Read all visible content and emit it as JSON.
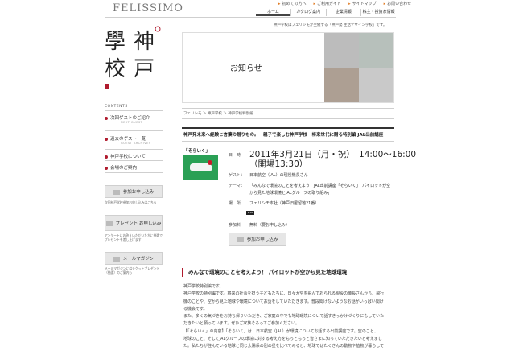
{
  "header": {
    "logo": "FELISSIMO",
    "top_links": [
      "初めての方へ",
      "ご利用ガイド",
      "サイトマップ",
      "お問い合わせ"
    ],
    "main_nav": [
      "ホーム",
      "カタログ案内",
      "企業情報",
      "株主・投資家情報"
    ]
  },
  "intro_text": "神戸学校はフェリシモが主催する「神戸発 生活デザイン学校」です。",
  "sidebar": {
    "stamp_text": "學神校戸",
    "contents_label": "CONTENTS",
    "items": [
      {
        "label": "次回ゲストのご紹介",
        "sub": "NEXT GUEST"
      },
      {
        "label": "過去のゲスト一覧",
        "sub": "GUEST ARCHIVES"
      },
      {
        "label": "神戸学校について",
        "sub": ""
      },
      {
        "label": "会場のご案内",
        "sub": ""
      }
    ],
    "apply_button": "参加お申し込み",
    "apply_note": "次回神戸学校参加お申し込みはこちら",
    "present_button": "プレゼント お申し込み",
    "present_note": "アンケートにお答えいただいた方に抽選でプレゼントを差し上げます",
    "mail_button": "メールマガジン",
    "mail_note": "メールマガジンにはチケットプレゼント（抽選）のご案内も"
  },
  "hero": {
    "title": "お知らせ",
    "colors": [
      "#bcbcbc",
      "#b7c0bb",
      "#ad9f93",
      "#c9c9c9"
    ]
  },
  "breadcrumb": "フェリシモ ＞ 神戸学校 ＞ 神戸学校特別編",
  "event": {
    "title": "神戸発未来へ経験と言葉の贈りもの。　親子で楽しむ神戸学校　将来世代に贈る特別編 JAL出前講座",
    "image_label": "「そらいく」",
    "date_label": "日　時",
    "date_value": "2011年3月21日（月・祝）　14:00〜16:00",
    "open_time": "（開場13:30）",
    "guest_label": "ゲスト：",
    "guest_value": "日本航空（JAL）の現役機長さん",
    "theme_label": "テーマ：",
    "theme_value": "「みんなで環境のことを考えよう　JAL出前講座「そらいく」　パイロットが空から見た地球環境とJALグループの取り組み」",
    "venue_label": "場　所",
    "venue_value": "フェリシモ本社（神戸旧居留地21番）",
    "map_button": "MAP",
    "fee_label": "参加料",
    "fee_value": "無料（要お申し込み）",
    "apply_button": "参加お申し込み"
  },
  "section": {
    "heading": "みんなで環境のことを考えよう！ パイロットが空から見た地球環境",
    "lines": [
      "神戸学校特別編です。",
      "神戸学校の特別編です。将来の社会を担う子どもたちに、日々大空を飛んでおられる現役の機長さんから、飛行",
      "機のことや、空から見た地球や環境についてお話をしていただきます。普段聞けないようなお話がいっぱい聞け",
      "る機会です。",
      "また、多くの気づきをお持ち帰りいただき、ご家庭の中でも地球環境について話すきっかけづくりにもしていた",
      "だきたいと願っています。ぜひご家族そろってご参加ください。",
      "【「そらいく」の内容】「そらいく」は、日本航空（JAL）が環境についてお話する出前講座です。空のこと、",
      "地球のこと、そしてJALグループの環境に対する考え方をもっともっと皆さまに知っていただきたいと考えまし",
      "た。私たちが住んでいる地球と同じ太陽系の別の星を比べてみると、地球ではたくさんの動物や植物が暮らして"
    ]
  }
}
